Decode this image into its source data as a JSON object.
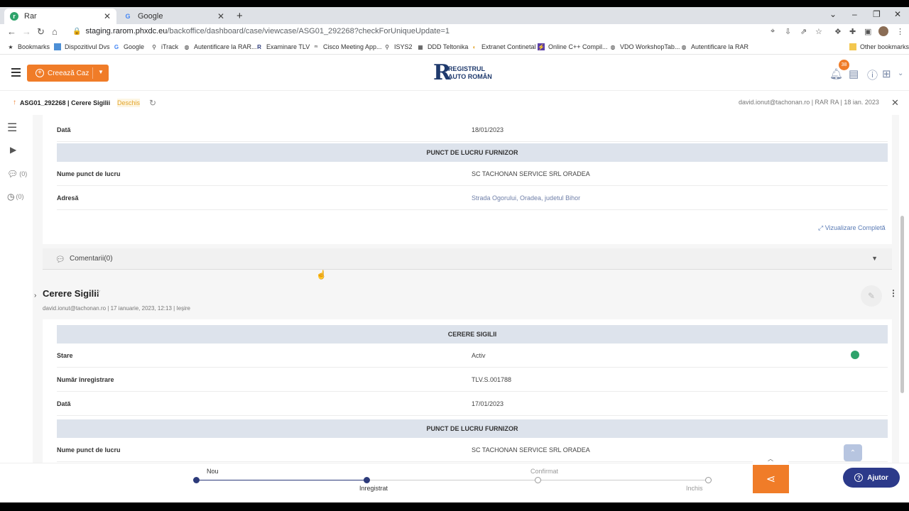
{
  "browser": {
    "tabs": [
      {
        "label": "Rar",
        "active": true
      },
      {
        "label": "Google",
        "active": false
      }
    ],
    "url_host": "staging.rarom.phxdc.eu",
    "url_path": "/backoffice/dashboard/case/viewcase/ASG01_292268?checkForUniqueUpdate=1",
    "bookmarks": [
      "Bookmarks",
      "Dispozitivul Dvs",
      "Google",
      "iTrack",
      "Autentificare la RAR...",
      "Examinare TLV",
      "Cisco Meeting App...",
      "ISYS2",
      "DDD Teltonika",
      "Extranet Continetal",
      "Online C++ Compil...",
      "VDO WorkshopTab...",
      "Autentificare la RAR"
    ],
    "other_bookmarks": "Other bookmarks"
  },
  "header": {
    "create_button": "Creează Caz",
    "logo_line1": "REGISTRUL",
    "logo_line2": "AUTO ROMÂN",
    "notification_count": "38"
  },
  "case": {
    "id_title": "ASG01_292268 | Cerere Sigilii",
    "status": "Deschis",
    "meta": "david.ionut@tachonan.ro | RAR RA | 18 ian. 2023"
  },
  "rail": {
    "comments_count": "(0)",
    "history_count": "(0)"
  },
  "entry1": {
    "date_label": "Dată",
    "date_value": "18/01/2023",
    "section_title": "PUNCT DE LUCRU FURNIZOR",
    "workpoint_label": "Nume punct de lucru",
    "workpoint_value": "SC TACHONAN SERVICE SRL ORADEA",
    "address_label": "Adresă",
    "address_value": "Strada Ogorului, Oradea, judetul Bihor",
    "view_all": "Vizualizare Completă"
  },
  "comments": {
    "label": "Comentarii(0)"
  },
  "entry2": {
    "title": "Cerere Sigilii",
    "meta": "david.ionut@tachonan.ro | 17 ianuarie, 2023, 12:13 | Ieșire",
    "section_title": "CERERE SIGILII",
    "state_label": "Stare",
    "state_value": "Activ",
    "regno_label": "Număr înregistrare",
    "regno_value": "TLV.S.001788",
    "date_label": "Dată",
    "date_value": "17/01/2023",
    "section2_title": "PUNCT DE LUCRU FURNIZOR",
    "workpoint_label": "Nume punct de lucru",
    "workpoint_value": "SC TACHONAN SERVICE SRL ORADEA"
  },
  "workflow": {
    "steps": [
      {
        "label": "Nou",
        "done": true
      },
      {
        "label": "Inregistrat",
        "done": true
      },
      {
        "label": "Confirmat",
        "done": false
      },
      {
        "label": "Inchis",
        "done": false
      }
    ]
  },
  "help_button": "Ajutor",
  "colors": {
    "accent": "#f07c28",
    "brand": "#1f3a6d",
    "section_bg": "#dde3ec",
    "status_active": "#2ea36b",
    "help_bg": "#2c3a8a"
  }
}
